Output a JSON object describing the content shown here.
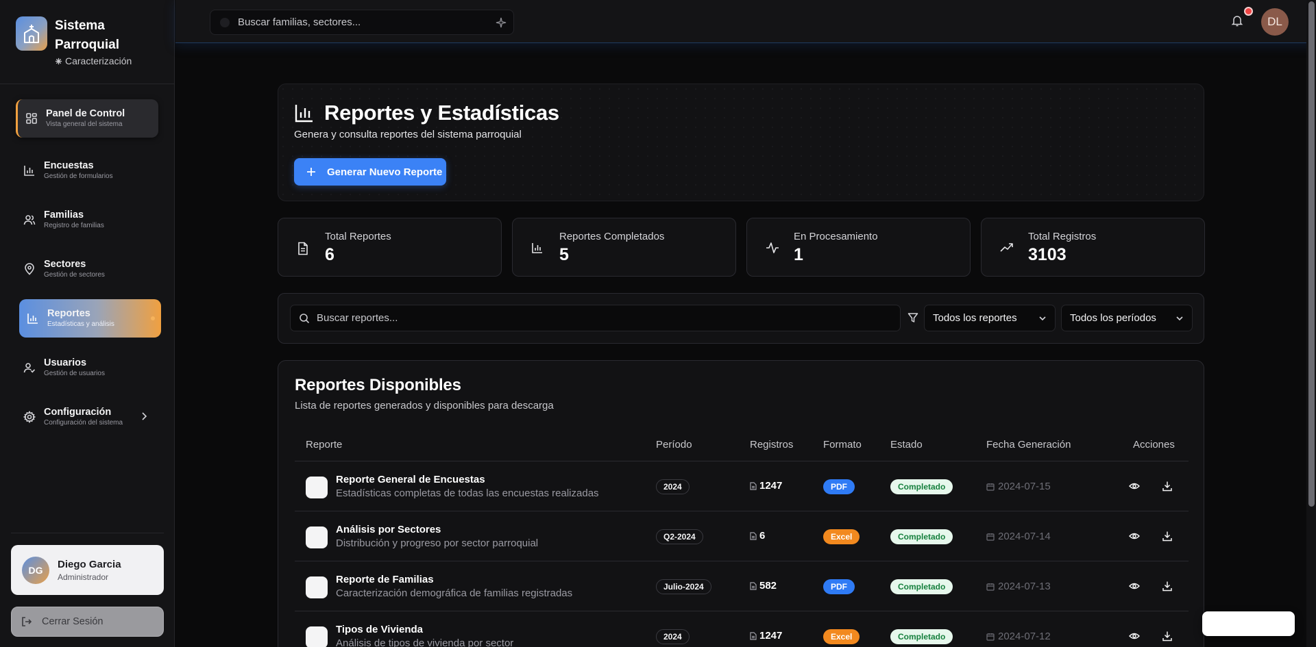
{
  "brand": {
    "title": "Sistema Parroquial",
    "subtitle": "Caracterización",
    "logo_icon": "church-icon"
  },
  "colors": {
    "accent_blue": "#3b82f6",
    "accent_orange": "#f0a040",
    "pdf_badge": "#2f7bf5",
    "excel_badge": "#f2891f",
    "completed_badge": "#e6f7ec"
  },
  "sidebar": {
    "items": [
      {
        "label": "Panel de Control",
        "desc": "Vista general del sistema",
        "icon": "dashboard-icon"
      },
      {
        "label": "Encuestas",
        "desc": "Gestión de formularios",
        "icon": "bar-chart-icon"
      },
      {
        "label": "Familias",
        "desc": "Registro de familias",
        "icon": "users-icon"
      },
      {
        "label": "Sectores",
        "desc": "Gestión de sectores",
        "icon": "map-pin-icon"
      },
      {
        "label": "Reportes",
        "desc": "Estadísticas y análisis",
        "icon": "bar-chart-icon"
      },
      {
        "label": "Usuarios",
        "desc": "Gestión de usuarios",
        "icon": "user-check-icon"
      },
      {
        "label": "Configuración",
        "desc": "Configuración del sistema",
        "icon": "gear-icon"
      }
    ],
    "user": {
      "initials": "DG",
      "name": "Diego Garcia",
      "role": "Administrador"
    },
    "logout_label": "Cerrar Sesión"
  },
  "header": {
    "search_placeholder": "Buscar familias, sectores...",
    "avatar_initials": "DL"
  },
  "hero": {
    "title": "Reportes y Estadísticas",
    "subtitle": "Genera y consulta reportes del sistema parroquial",
    "button_label": "Generar Nuevo Reporte"
  },
  "stats": [
    {
      "label": "Total Reportes",
      "value": "6",
      "icon": "file-text-icon"
    },
    {
      "label": "Reportes Completados",
      "value": "5",
      "icon": "bar-chart-icon"
    },
    {
      "label": "En Procesamiento",
      "value": "1",
      "icon": "activity-icon"
    },
    {
      "label": "Total Registros",
      "value": "3103",
      "icon": "trending-up-icon"
    }
  ],
  "filters": {
    "search_placeholder": "Buscar reportes...",
    "type_selected": "Todos los reportes",
    "period_selected": "Todos los períodos"
  },
  "table": {
    "title": "Reportes Disponibles",
    "subtitle": "Lista de reportes generados y disponibles para descarga",
    "columns": [
      "Reporte",
      "Período",
      "Registros",
      "Formato",
      "Estado",
      "Fecha Generación",
      "Acciones"
    ],
    "rows": [
      {
        "name": "Reporte General de Encuestas",
        "desc": "Estadísticas completas de todas las encuestas realizadas",
        "period": "2024",
        "records": "1247",
        "format": "PDF",
        "status": "Completado",
        "date": "2024-07-15"
      },
      {
        "name": "Análisis por Sectores",
        "desc": "Distribución y progreso por sector parroquial",
        "period": "Q2-2024",
        "records": "6",
        "format": "Excel",
        "status": "Completado",
        "date": "2024-07-14"
      },
      {
        "name": "Reporte de Familias",
        "desc": "Caracterización demográfica de familias registradas",
        "period": "Julio-2024",
        "records": "582",
        "format": "PDF",
        "status": "Completado",
        "date": "2024-07-13"
      },
      {
        "name": "Tipos de Vivienda",
        "desc": "Análisis de tipos de vivienda por sector",
        "period": "2024",
        "records": "1247",
        "format": "Excel",
        "status": "Completado",
        "date": "2024-07-12"
      }
    ]
  }
}
